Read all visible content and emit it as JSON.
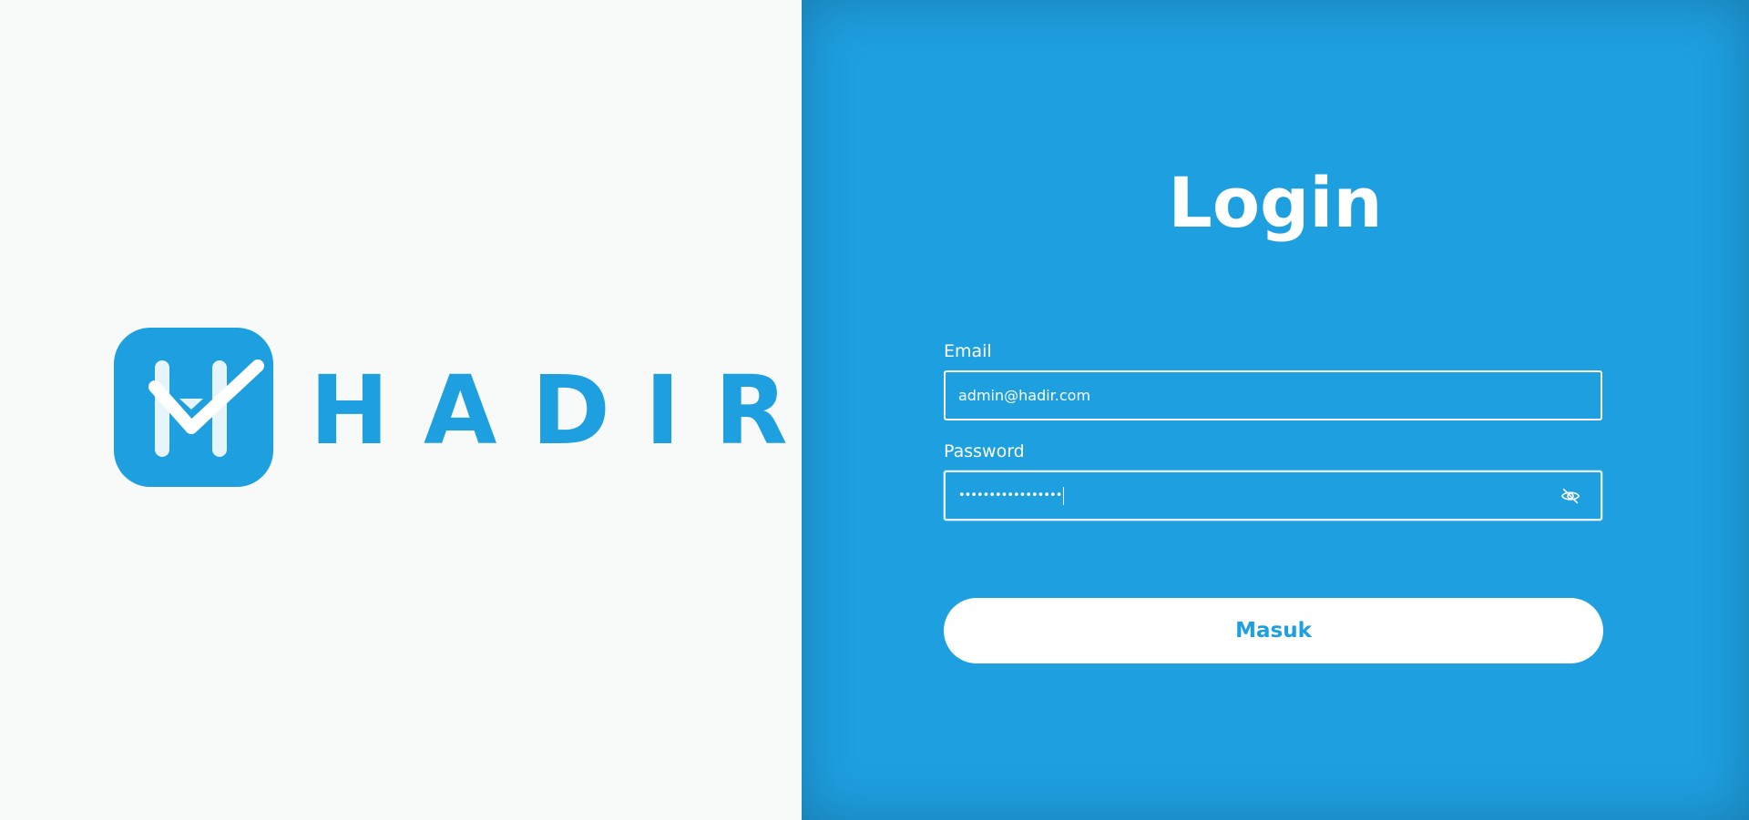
{
  "brand": {
    "name": "HADIR",
    "logo_icon": "hadir-check-logo-icon",
    "accent_color": "#1e9fe0",
    "left_background": "#f8faf9"
  },
  "login": {
    "title": "Login",
    "email": {
      "label": "Email",
      "value": "admin@hadir.com"
    },
    "password": {
      "label": "Password",
      "masked_value": "•••••••••••••••••",
      "toggle_icon": "eye-off-icon"
    },
    "submit_label": "Masuk"
  }
}
